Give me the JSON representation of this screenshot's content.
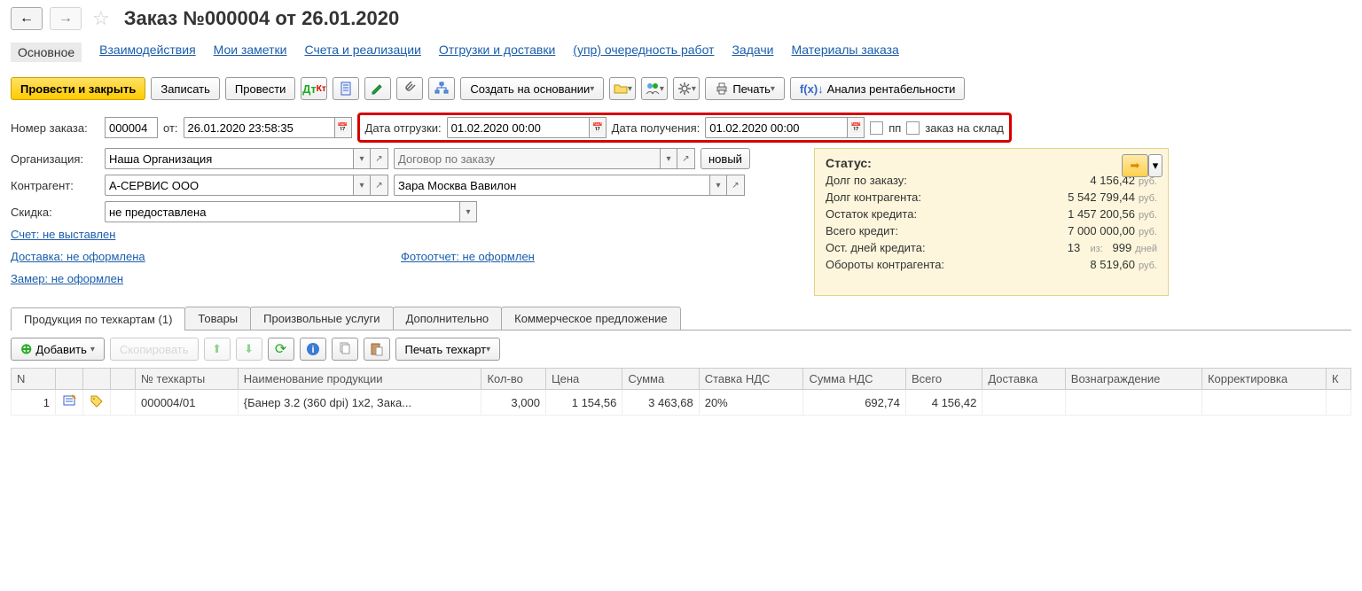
{
  "title": "Заказ №000004 от 26.01.2020",
  "topTabs": {
    "main": "Основное",
    "interactions": "Взаимодействия",
    "notes": "Мои заметки",
    "invoices": "Счета и реализации",
    "shipments": "Отгрузки и доставки",
    "workorder": "(упр) очередность работ",
    "tasks": "Задачи",
    "materials": "Материалы заказа"
  },
  "toolbar": {
    "postClose": "Провести и закрыть",
    "save": "Записать",
    "post": "Провести",
    "createBased": "Создать на основании",
    "print": "Печать",
    "profitability": "Анализ рентабельности"
  },
  "form": {
    "orderNoLabel": "Номер заказа:",
    "orderNo": "000004",
    "fromLabel": "от:",
    "orderDate": "26.01.2020 23:58:35",
    "shipDateLabel": "Дата отгрузки:",
    "shipDate": "01.02.2020 00:00",
    "recvDateLabel": "Дата получения:",
    "recvDate": "01.02.2020 00:00",
    "ppLabel": "пп",
    "toStockLabel": "заказ на склад",
    "orgLabel": "Организация:",
    "org": "Наша Организация",
    "contractPh": "Договор по заказу",
    "newBtn": "новый",
    "counterpartyLabel": "Контрагент:",
    "counterparty": "А-СЕРВИС ООО",
    "shop": "Зара Москва Вавилон",
    "discountLabel": "Скидка:",
    "discount": "не предоставлена",
    "invoiceLink": "Счет: не выставлен",
    "deliveryLink": "Доставка: не оформлена",
    "measureLink": "Замер: не оформлен",
    "photoLink": "Фотоотчет: не оформлен"
  },
  "status": {
    "hdr": "Статус:",
    "debtOrderLbl": "Долг по заказу:",
    "debtOrder": "4 156,42",
    "debtCpLbl": "Долг контрагента:",
    "debtCp": "5 542 799,44",
    "creditRemLbl": "Остаток кредита:",
    "creditRem": "1 457 200,56",
    "creditTotalLbl": "Всего кредит:",
    "creditTotal": "7 000 000,00",
    "daysRemLbl": "Ост. дней кредита:",
    "daysRem": "13",
    "daysOf": "из:",
    "daysTotal": "999",
    "daysUnit": "дней",
    "turnoverLbl": "Обороты контрагента:",
    "turnover": "8 519,60",
    "rub": "руб."
  },
  "gridTabs": {
    "tech": "Продукция по техкартам (1)",
    "goods": "Товары",
    "services": "Произвольные услуги",
    "extra": "Дополнительно",
    "offer": "Коммерческое предложение"
  },
  "gridToolbar": {
    "add": "Добавить",
    "copy": "Скопировать",
    "printTech": "Печать техкарт"
  },
  "gridHeaders": {
    "n": "N",
    "techNo": "№ техкарты",
    "name": "Наименование продукции",
    "qty": "Кол-во",
    "price": "Цена",
    "sum": "Сумма",
    "vatRate": "Ставка НДС",
    "vatSum": "Сумма НДС",
    "total": "Всего",
    "delivery": "Доставка",
    "reward": "Вознаграждение",
    "adjust": "Корректировка",
    "k": "К"
  },
  "gridRow": {
    "n": "1",
    "techNo": "000004/01",
    "name": "{Банер 3.2 (360 dpi)  1x2, Зака...",
    "qty": "3,000",
    "price": "1 154,56",
    "sum": "3 463,68",
    "vatRate": "20%",
    "vatSum": "692,74",
    "total": "4 156,42"
  }
}
